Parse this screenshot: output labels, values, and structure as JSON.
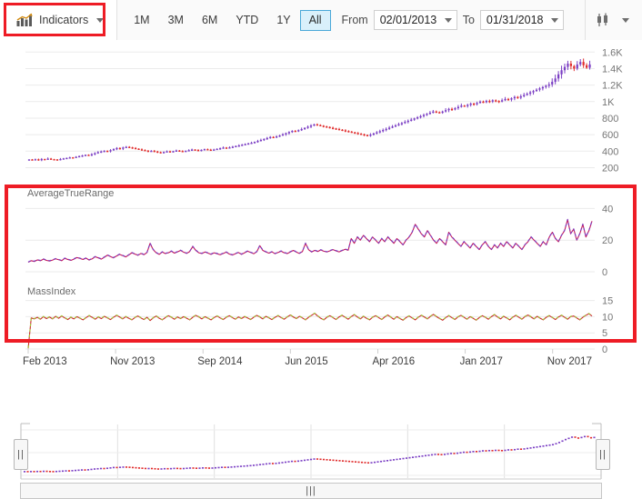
{
  "toolbar": {
    "indicators": {
      "label": "Indicators",
      "icon": "bar-chart-trend-icon",
      "caret": "chevron-down-icon"
    },
    "range_buttons": [
      {
        "label": "1M",
        "selected": false
      },
      {
        "label": "3M",
        "selected": false
      },
      {
        "label": "6M",
        "selected": false
      },
      {
        "label": "YTD",
        "selected": false
      },
      {
        "label": "1Y",
        "selected": false
      },
      {
        "label": "All",
        "selected": true
      }
    ],
    "from_label": "From",
    "from_value": "02/01/2013",
    "to_label": "To",
    "to_value": "01/31/2018",
    "chart_type": {
      "icon": "candlestick-icon",
      "caret": "chevron-down-icon"
    }
  },
  "annotations": {
    "highlight_color": "#ee1c25",
    "boxes": [
      "indicators-button-highlight",
      "indicator-panels-highlight"
    ]
  },
  "navigator": {
    "left_handle_grip": "||",
    "right_handle_grip": "||",
    "scrollbar_grip": "|||"
  },
  "chart_data": [
    {
      "type": "candlestick",
      "name": "price-panel",
      "title": "",
      "ylabel": "",
      "xlabel": "",
      "ylim": [
        150,
        1680
      ],
      "yticks": [
        200,
        400,
        600,
        800,
        1000,
        1200,
        1400,
        1600
      ],
      "ytick_labels": [
        "200",
        "400",
        "600",
        "800",
        "1K",
        "1.2K",
        "1.4K",
        "1.6K"
      ],
      "grid": true,
      "up_color": "#7b3fc4",
      "down_color": "#e02b2b",
      "x_range": [
        "Feb 2013",
        "Jan 2018"
      ],
      "values": [
        300,
        296,
        302,
        292,
        305,
        298,
        310,
        303,
        300,
        296,
        305,
        312,
        318,
        325,
        320,
        332,
        340,
        348,
        356,
        350,
        362,
        375,
        388,
        396,
        404,
        398,
        412,
        425,
        438,
        430,
        444,
        452,
        446,
        438,
        430,
        422,
        414,
        406,
        398,
        404,
        396,
        388,
        382,
        390,
        398,
        392,
        400,
        408,
        402,
        396,
        404,
        412,
        420,
        414,
        408,
        416,
        424,
        418,
        412,
        420,
        428,
        436,
        444,
        438,
        446,
        454,
        462,
        470,
        478,
        486,
        494,
        502,
        512,
        524,
        536,
        548,
        560,
        572,
        566,
        578,
        590,
        604,
        618,
        632,
        646,
        640,
        654,
        668,
        682,
        696,
        710,
        724,
        716,
        708,
        700,
        692,
        684,
        676,
        668,
        660,
        652,
        644,
        636,
        628,
        620,
        612,
        604,
        596,
        588,
        600,
        614,
        628,
        642,
        656,
        670,
        684,
        698,
        712,
        726,
        740,
        754,
        768,
        782,
        796,
        810,
        824,
        838,
        852,
        866,
        880,
        872,
        864,
        880,
        896,
        912,
        904,
        920,
        936,
        952,
        944,
        960,
        976,
        968,
        984,
        1000,
        992,
        1008,
        1000,
        1016,
        1008,
        1000,
        1016,
        1032,
        1024,
        1040,
        1056,
        1048,
        1064,
        1080,
        1096,
        1112,
        1128,
        1144,
        1160,
        1176,
        1192,
        1208,
        1240,
        1280,
        1330,
        1380,
        1420,
        1460,
        1430,
        1400,
        1450,
        1480,
        1440,
        1410,
        1450
      ]
    },
    {
      "type": "line",
      "name": "average-true-range-panel",
      "title": "AverageTrueRange",
      "ylim": [
        0,
        46
      ],
      "yticks": [
        0,
        20,
        40
      ],
      "ytick_labels": [
        "0",
        "20",
        "40"
      ],
      "grid": true,
      "series": [
        {
          "name": "AverageTrueRange",
          "color": "#c2185b",
          "values": [
            6,
            7,
            6.5,
            7.5,
            7,
            8,
            7.2,
            6.8,
            7.4,
            8.2,
            7.6,
            7,
            8.5,
            7.8,
            7.2,
            8,
            9,
            8.4,
            7.8,
            8.6,
            7.4,
            8.2,
            9.5,
            8.8,
            8,
            9.2,
            10.5,
            9.6,
            8.8,
            10,
            11,
            10.2,
            9.4,
            10.6,
            12,
            11.2,
            10.4,
            11.6,
            10.8,
            12.2,
            18,
            14,
            12,
            11,
            12.5,
            11.5,
            12,
            13,
            11.8,
            12.6,
            13.5,
            12.4,
            11.6,
            12.8,
            16,
            13.5,
            12,
            11.5,
            12.5,
            11.8,
            11,
            12,
            11.4,
            10.8,
            11.6,
            12.4,
            11.2,
            10.6,
            11.4,
            12.2,
            11,
            12,
            13,
            12.2,
            11.4,
            12.6,
            16.5,
            13.5,
            12.5,
            11.8,
            12.6,
            11.4,
            12.2,
            13,
            12,
            11.5,
            12.5,
            13.5,
            12.4,
            11.6,
            12.8,
            18,
            14,
            12.5,
            13.5,
            12.8,
            13.8,
            13,
            12.5,
            13.2,
            14,
            13.2,
            12.6,
            13.4,
            14.2,
            13.6,
            21,
            18,
            22,
            20,
            23,
            21,
            19,
            22,
            20,
            18,
            21,
            19,
            22,
            20,
            18,
            21,
            19,
            17,
            20,
            22,
            25,
            30,
            27,
            24,
            22,
            26,
            23,
            20,
            18,
            21,
            19,
            17,
            25,
            22,
            20,
            18,
            16,
            19,
            17,
            15,
            18,
            16,
            14,
            17,
            19,
            16,
            14,
            17,
            15,
            18,
            16,
            19,
            17,
            15,
            18,
            16,
            14,
            17,
            19,
            22,
            20,
            18,
            16,
            19,
            17,
            22,
            25,
            21,
            19,
            23,
            26,
            33,
            24,
            27,
            20,
            24,
            30,
            22,
            26,
            32
          ]
        },
        {
          "name": "AverageTrueRange-overlay",
          "color": "#7b3fc4",
          "values": [
            6.2,
            7.2,
            6.7,
            7.7,
            7.2,
            8.2,
            7.4,
            7.0,
            7.6,
            8.4,
            7.8,
            7.2,
            8.7,
            8.0,
            7.4,
            8.2,
            9.2,
            8.6,
            8.0,
            8.8,
            7.6,
            8.4,
            9.7,
            9.0,
            8.2,
            9.4,
            10.7,
            9.8,
            9.0,
            10.2,
            11.2,
            10.4,
            9.6,
            10.8,
            12.2,
            11.4,
            10.6,
            11.8,
            11.0,
            12.4,
            18.2,
            14.2,
            12.2,
            11.2,
            12.7,
            11.7,
            12.2,
            13.2,
            12.0,
            12.8,
            13.7,
            12.6,
            11.8,
            13.0,
            16.2,
            13.7,
            12.2,
            11.7,
            12.7,
            12.0,
            11.2,
            12.2,
            11.6,
            11.0,
            11.8,
            12.6,
            11.4,
            10.8,
            11.6,
            12.4,
            11.2,
            12.2,
            13.2,
            12.4,
            11.6,
            12.8,
            16.7,
            13.7,
            12.7,
            12.0,
            12.8,
            11.6,
            12.4,
            13.2,
            12.2,
            11.7,
            12.7,
            13.7,
            12.6,
            11.8,
            13.0,
            18.2,
            14.2,
            12.7,
            13.7,
            13.0,
            14.0,
            13.2,
            12.7,
            13.4,
            14.2,
            13.4,
            12.8,
            13.6,
            14.4,
            13.8,
            21.2,
            18.2,
            22.2,
            20.2,
            23.2,
            21.2,
            19.2,
            22.2,
            20.2,
            18.2,
            21.2,
            19.2,
            22.2,
            20.2,
            18.2,
            21.2,
            19.2,
            17.2,
            20.2,
            22.2,
            25.2,
            30.2,
            27.2,
            24.2,
            22.2,
            26.2,
            23.2,
            20.2,
            18.2,
            21.2,
            19.2,
            17.2,
            25.2,
            22.2,
            20.2,
            18.2,
            16.2,
            19.2,
            17.2,
            15.2,
            18.2,
            16.2,
            14.2,
            17.2,
            19.2,
            16.2,
            14.2,
            17.2,
            15.2,
            18.2,
            16.2,
            19.2,
            17.2,
            15.2,
            18.2,
            16.2,
            14.2,
            17.2,
            19.2,
            22.2,
            20.2,
            18.2,
            16.2,
            19.2,
            17.2,
            22.2,
            25.2,
            21.2,
            19.2,
            23.2,
            26.2,
            33.2,
            24.2,
            27.2,
            20.2,
            24.2,
            30.2,
            22.2,
            26.2,
            32.2
          ]
        }
      ]
    },
    {
      "type": "line",
      "name": "mass-index-panel",
      "title": "MassIndex",
      "ylim": [
        0,
        16
      ],
      "yticks": [
        0,
        5,
        10,
        15
      ],
      "ytick_labels": [
        "0",
        "5",
        "10",
        "15"
      ],
      "grid": true,
      "series": [
        {
          "name": "MassIndex",
          "color": "#c92a2a",
          "values": [
            0.2,
            9.6,
            9.3,
            9.8,
            9.2,
            10.0,
            9.4,
            9.9,
            9.3,
            10.1,
            9.5,
            10.2,
            9.6,
            9.1,
            9.8,
            9.3,
            10.0,
            9.5,
            9.0,
            9.7,
            10.3,
            9.8,
            9.2,
            9.9,
            9.4,
            10.1,
            9.6,
            9.1,
            9.8,
            10.4,
            9.9,
            9.3,
            10.0,
            9.5,
            9.0,
            9.7,
            10.2,
            9.6,
            9.1,
            9.8,
            8.8,
            9.6,
            10.2,
            9.5,
            9.0,
            9.7,
            10.3,
            9.8,
            9.2,
            9.9,
            9.4,
            10.0,
            9.5,
            9.0,
            9.8,
            10.4,
            9.9,
            9.3,
            10.0,
            9.5,
            9.0,
            9.7,
            10.2,
            9.6,
            9.1,
            9.8,
            10.3,
            9.7,
            9.2,
            9.9,
            9.4,
            10.0,
            9.6,
            9.1,
            9.8,
            10.4,
            9.9,
            9.3,
            10.1,
            9.6,
            9.1,
            9.8,
            10.3,
            9.7,
            9.2,
            9.9,
            10.5,
            9.9,
            9.4,
            10.1,
            9.6,
            9.0,
            9.8,
            10.4,
            11.0,
            10.2,
            9.5,
            9.0,
            9.8,
            10.3,
            9.7,
            9.1,
            9.9,
            10.4,
            9.8,
            9.2,
            10.0,
            10.6,
            9.9,
            9.3,
            10.1,
            9.5,
            9.0,
            9.8,
            10.3,
            9.7,
            9.1,
            9.9,
            10.5,
            9.8,
            9.2,
            10.0,
            9.4,
            8.9,
            9.7,
            10.2,
            9.6,
            9.0,
            9.8,
            10.4,
            9.9,
            9.3,
            10.1,
            10.7,
            10.0,
            9.4,
            8.9,
            9.7,
            10.3,
            9.7,
            9.1,
            9.9,
            10.4,
            9.8,
            9.2,
            10.0,
            9.5,
            8.9,
            9.7,
            10.3,
            9.8,
            9.2,
            10.0,
            10.6,
            9.9,
            9.3,
            10.1,
            9.6,
            9.0,
            9.8,
            10.4,
            9.8,
            9.2,
            10.0,
            10.5,
            9.9,
            9.3,
            10.1,
            9.5,
            9.0,
            9.8,
            10.3,
            9.7,
            9.1,
            9.9,
            10.4,
            9.8,
            9.2,
            10.0,
            10.2,
            9.6,
            9.0,
            9.8,
            10.4,
            10.9,
            10.2
          ]
        },
        {
          "name": "MassIndex-overlay",
          "color": "#a4c639",
          "values": [
            0.3,
            9.7,
            9.4,
            9.9,
            9.3,
            10.1,
            9.5,
            10.0,
            9.4,
            10.2,
            9.6,
            10.3,
            9.7,
            9.2,
            9.9,
            9.4,
            10.1,
            9.6,
            9.1,
            9.8,
            10.4,
            9.9,
            9.3,
            10.0,
            9.5,
            10.2,
            9.7,
            9.2,
            9.9,
            10.5,
            10.0,
            9.4,
            10.1,
            9.6,
            9.1,
            9.8,
            10.3,
            9.7,
            9.2,
            9.9,
            8.9,
            9.7,
            10.3,
            9.6,
            9.1,
            9.8,
            10.4,
            9.9,
            9.3,
            10.0,
            9.5,
            10.1,
            9.6,
            9.1,
            9.9,
            10.5,
            10.0,
            9.4,
            10.1,
            9.6,
            9.1,
            9.8,
            10.3,
            9.7,
            9.2,
            9.9,
            10.4,
            9.8,
            9.3,
            10.0,
            9.5,
            10.1,
            9.7,
            9.2,
            9.9,
            10.5,
            10.0,
            9.4,
            10.2,
            9.7,
            9.2,
            9.9,
            10.4,
            9.8,
            9.3,
            10.0,
            10.6,
            10.0,
            9.5,
            10.2,
            9.7,
            9.1,
            9.9,
            10.5,
            11.1,
            10.3,
            9.6,
            9.1,
            9.9,
            10.4,
            9.8,
            9.2,
            10.0,
            10.5,
            9.9,
            9.3,
            10.1,
            10.7,
            10.0,
            9.4,
            10.2,
            9.6,
            9.1,
            9.9,
            10.4,
            9.8,
            9.2,
            10.0,
            10.6,
            9.9,
            9.3,
            10.1,
            9.5,
            9.0,
            9.8,
            10.3,
            9.7,
            9.1,
            9.9,
            10.5,
            10.0,
            9.4,
            10.2,
            10.8,
            10.1,
            9.5,
            9.0,
            9.8,
            10.4,
            9.8,
            9.2,
            10.0,
            10.5,
            9.9,
            9.3,
            10.1,
            9.6,
            9.0,
            9.8,
            10.4,
            9.9,
            9.3,
            10.1,
            10.7,
            10.0,
            9.4,
            10.2,
            9.7,
            9.1,
            9.9,
            10.5,
            9.9,
            9.3,
            10.1,
            10.6,
            10.0,
            9.4,
            10.2,
            9.6,
            9.1,
            9.9,
            10.4,
            9.8,
            9.2,
            10.0,
            10.5,
            9.9,
            9.3,
            10.1,
            10.3,
            9.7,
            9.1,
            9.9,
            10.5,
            11.0,
            10.3
          ]
        }
      ]
    },
    {
      "type": "candlestick",
      "name": "navigator-overview-panel",
      "ylim": [
        150,
        1680
      ],
      "grid": true,
      "up_color": "#7b3fc4",
      "down_color": "#e02b2b"
    }
  ],
  "x_axis": {
    "labels": [
      "Feb 2013",
      "Nov 2013",
      "Sep 2014",
      "Jun 2015",
      "Apr 2016",
      "Jan 2017",
      "Nov 2017"
    ]
  }
}
